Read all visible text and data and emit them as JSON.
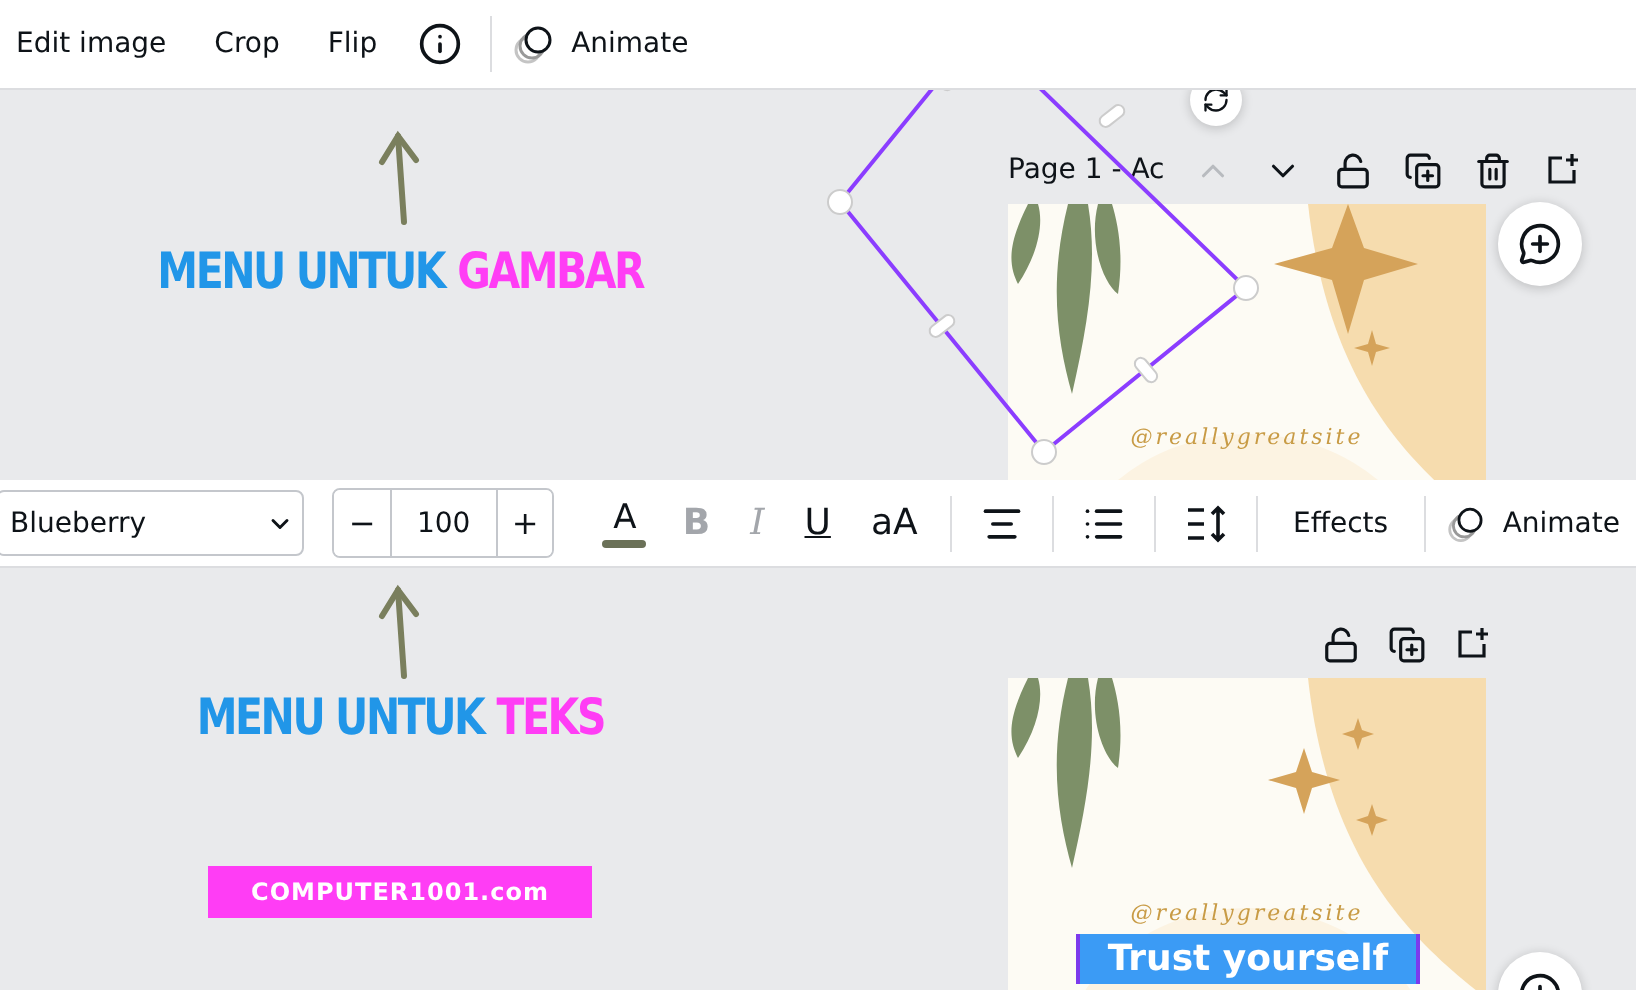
{
  "image_panel": {
    "toolbar": [
      {
        "kind": "button",
        "label": "Edit image"
      },
      {
        "kind": "button",
        "label": "Crop"
      },
      {
        "kind": "button",
        "label": "Flip"
      },
      {
        "kind": "info"
      },
      {
        "kind": "divider"
      },
      {
        "kind": "animate",
        "label": "Animate"
      }
    ],
    "caption": [
      {
        "text": "MENU UNTUK",
        "color": "#2196e8"
      },
      {
        "text": "GAMBAR",
        "color": "#ff3df5"
      }
    ],
    "page_label": "Page 1 - Ac",
    "page_actions": [
      {
        "kind": "up"
      },
      {
        "kind": "down"
      },
      {
        "kind": "lock"
      },
      {
        "kind": "duplicate"
      },
      {
        "kind": "delete"
      },
      {
        "kind": "add"
      }
    ],
    "design": {
      "handle": "@reallygreatsite"
    }
  },
  "text_panel": {
    "toolbar": [
      {
        "kind": "font",
        "value": "Blueberry"
      },
      {
        "kind": "size",
        "minus": "−",
        "value": "100",
        "plus": "+"
      },
      {
        "kind": "color",
        "label": "A"
      },
      {
        "kind": "bold",
        "label": "B",
        "disabled": true
      },
      {
        "kind": "italic",
        "label": "I",
        "disabled": true
      },
      {
        "kind": "underline",
        "label": "U",
        "disabled": false
      },
      {
        "kind": "case",
        "label": "aA"
      },
      {
        "kind": "divider"
      },
      {
        "kind": "align"
      },
      {
        "kind": "divider"
      },
      {
        "kind": "list"
      },
      {
        "kind": "divider"
      },
      {
        "kind": "spacing"
      },
      {
        "kind": "divider"
      },
      {
        "kind": "button",
        "label": "Effects"
      },
      {
        "kind": "divider"
      },
      {
        "kind": "animate",
        "label": "Animate"
      }
    ],
    "caption": [
      {
        "text": "MENU UNTUK",
        "color": "#2196e8"
      },
      {
        "text": "TEKS",
        "color": "#ff3df5"
      }
    ],
    "site_badge": "COMPUTER1001.com",
    "page_actions": [
      {
        "kind": "lock"
      },
      {
        "kind": "duplicate"
      },
      {
        "kind": "add"
      }
    ],
    "design": {
      "handle": "@reallygreatsite",
      "selected_text": "Trust yourself"
    }
  }
}
